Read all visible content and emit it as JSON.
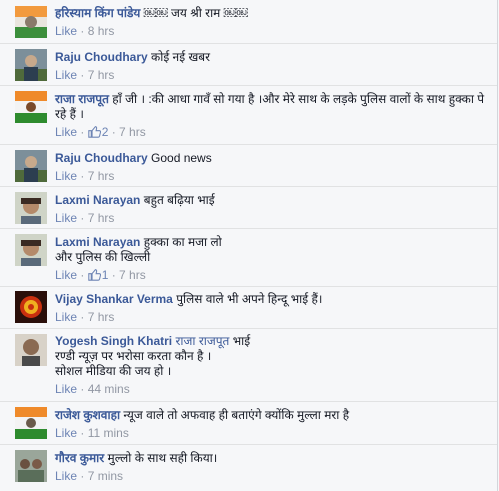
{
  "comments": [
    {
      "author": "हरिस्याम किंग पांडेय",
      "text": " ￼￼ जय श्री राम ￼￼",
      "like": "Like",
      "sep": " · ",
      "time": "8 hrs"
    },
    {
      "author": "Raju Choudhary",
      "text": " कोई नई खबर",
      "like": "Like",
      "sep": " · ",
      "time": "7 hrs"
    },
    {
      "author": "राजा राजपूत",
      "text": " हाँ जी । :की आधा गावँ सो गया है ।और मेरे साथ के लड़के पुलिस वालों के साथ हुक्का पे रहे हैं ।",
      "like": "Like",
      "sep": " · ",
      "likes_count": "2",
      "time": "7 hrs"
    },
    {
      "author": "Raju Choudhary",
      "text": " Good news",
      "like": "Like",
      "sep": " · ",
      "time": "7 hrs"
    },
    {
      "author": "Laxmi Narayan",
      "text": " बहुत बढ़िया भाई",
      "like": "Like",
      "sep": " · ",
      "time": "7 hrs"
    },
    {
      "author": "Laxmi Narayan",
      "text": " हुक्का का मजा लो",
      "text2": "और पुलिस की खिल्ली",
      "like": "Like",
      "sep": " · ",
      "likes_count": "1",
      "time": "7 hrs"
    },
    {
      "author": "Vijay Shankar Verma",
      "text": " पुलिस वाले भी अपने हिन्दू भाई हैं।",
      "like": "Like",
      "sep": " · ",
      "time": "7 hrs"
    },
    {
      "author": "Yogesh Singh Khatri",
      "mention": " राजा राजपूत",
      "text": " भाई",
      "text2": "रण्डी न्यूज़ पर भरोसा करता कौन है ।",
      "text3": "सोशल मीडिया की जय हो ।",
      "like": "Like",
      "sep": " · ",
      "time": "44 mins"
    },
    {
      "author": "राजेश कुशवाहा",
      "text": " न्यूज वाले तो अफवाह ही बताएंगे क्योंकि मुल्ला मरा है",
      "like": "Like",
      "sep": " · ",
      "time": "11 mins"
    },
    {
      "author": "गौरव कुमार",
      "text": " मुल्लो के साथ सही किया।",
      "like": "Like",
      "sep": " · ",
      "time": "7 mins"
    }
  ],
  "colors": {
    "link": "#3b5998",
    "meta": "#9197a3",
    "background": "#f6f7f9"
  }
}
